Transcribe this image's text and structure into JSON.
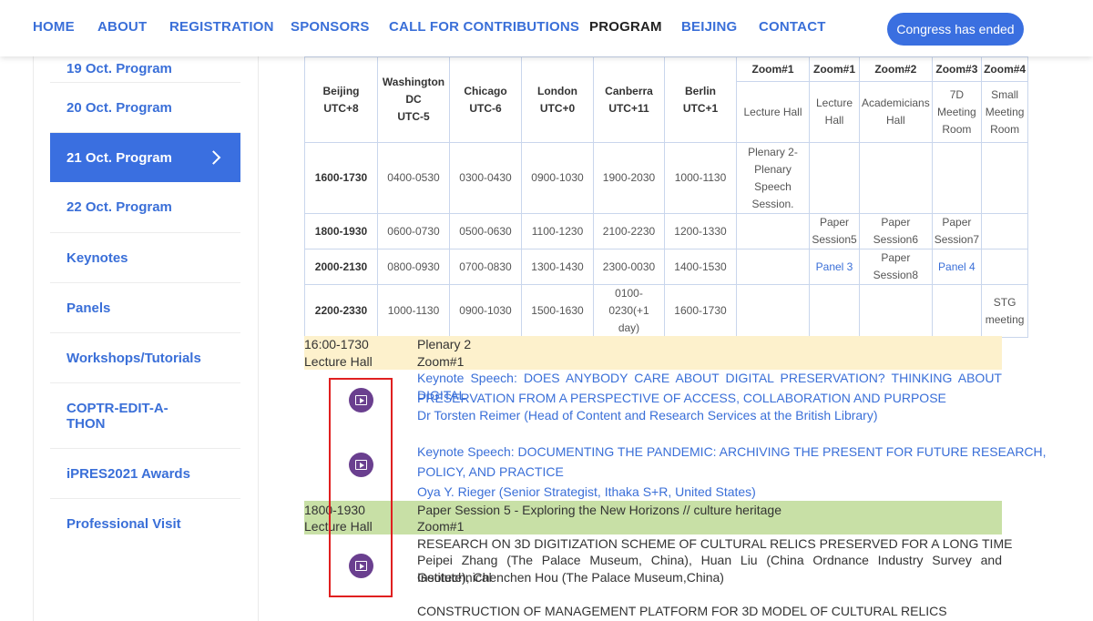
{
  "nav": {
    "items": [
      "HOME",
      "ABOUT",
      "REGISTRATION",
      "SPONSORS",
      "CALL FOR CONTRIBUTIONS",
      "PROGRAM",
      "BEIJING",
      "CONTACT"
    ],
    "button": "Congress has ended"
  },
  "sidebar": {
    "items": [
      "19 Oct. Program",
      "20 Oct. Program",
      "21 Oct. Program",
      "22 Oct. Program",
      "Keynotes",
      "Panels",
      "Workshops/Tutorials",
      "COPTR-EDIT-A-THON",
      "iPRES2021 Awards",
      "Professional Visit"
    ]
  },
  "table": {
    "header": {
      "beijing": [
        "Beijing",
        "UTC+8"
      ],
      "washington": [
        "Washington",
        "DC",
        "UTC-5"
      ],
      "chicago": [
        "Chicago",
        "UTC-6"
      ],
      "london": [
        "London",
        "UTC+0"
      ],
      "canberra": [
        "Canberra",
        "UTC+11"
      ],
      "berlin": [
        "Berlin",
        "UTC+1"
      ],
      "zoom_names": [
        "Zoom#1",
        "Zoom#1",
        "Zoom#2",
        "Zoom#3",
        "Zoom#4"
      ],
      "rooms": [
        [
          "Lecture Hall"
        ],
        [
          "Lecture",
          "Hall"
        ],
        [
          "Academicians",
          "Hall"
        ],
        [
          "7D",
          "Meeting",
          "Room"
        ],
        [
          "Small",
          "Meeting",
          "Room"
        ]
      ]
    },
    "rows": [
      {
        "times": [
          "1600-1730",
          "0400-0530",
          "0300-0430",
          "0900-1030",
          "1900-2030",
          "1000-1130"
        ],
        "plenary": [
          "Plenary 2-",
          "Plenary",
          "Speech",
          "Session."
        ]
      },
      {
        "times": [
          "1800-1930",
          "0600-0730",
          "0500-0630",
          "1100-1230",
          "2100-2230",
          "1200-1330"
        ],
        "z1b": [
          "Paper",
          "Session5"
        ],
        "z2": [
          "Paper",
          "Session6"
        ],
        "z3": [
          "Paper",
          "Session7"
        ]
      },
      {
        "times": [
          "2000-2130",
          "0800-0930",
          "0700-0830",
          "1300-1430",
          "2300-0030",
          "1400-1530"
        ],
        "z1b": "Panel 3",
        "z2": [
          "Paper",
          "Session8"
        ],
        "z3": "Panel 4"
      },
      {
        "times": [
          "2200-2330",
          "1000-1130",
          "0900-1030",
          "1500-1630",
          "0100-0230(+1",
          "day)",
          "1600-1730"
        ],
        "z4": [
          "STG",
          "meeting"
        ]
      }
    ]
  },
  "sessions": {
    "plenary": {
      "time": "16:00-1730",
      "place": "Lecture Hall",
      "title": "Plenary 2",
      "zoom": "Zoom#1",
      "keynote1_line1": "Keynote Speech: DOES ANYBODY CARE ABOUT DIGITAL PRESERVATION? THINKING ABOUT DIGITAL",
      "keynote1_line2": "PRESERVATION FROM A PERSPECTIVE OF ACCESS, COLLABORATION AND PURPOSE",
      "keynote1_speaker": "Dr Torsten Reimer (Head of Content and Research Services at the British Library)",
      "keynote2_line1": "Keynote Speech: DOCUMENTING THE PANDEMIC: ARCHIVING THE PRESENT FOR FUTURE RESEARCH,",
      "keynote2_line2": "POLICY, AND PRACTICE",
      "keynote2_speaker": "Oya Y. Rieger (Senior Strategist, Ithaka S+R, United States)"
    },
    "paper5": {
      "time": "1800-1930",
      "place": "Lecture Hall",
      "title": "Paper Session 5 - Exploring the New Horizons // culture heritage",
      "zoom": "Zoom#1",
      "paper1_title": "RESEARCH ON 3D DIGITIZATION SCHEME OF CULTURAL RELICS PRESERVED FOR A LONG TIME",
      "paper1_authors_line1": "Peipei Zhang (The Palace Museum, China), Huan Liu (China Ordnance Industry Survey and Geotechnical",
      "paper1_authors_line2": "Institute), Chenchen Hou (The Palace Museum,China)",
      "paper2_title": "CONSTRUCTION OF MANAGEMENT PLATFORM FOR 3D MODEL OF CULTURAL RELICS"
    }
  },
  "colors": {
    "accent": "#3a6fe0",
    "plenary_band": "#fdf1cc",
    "paper_band": "#c8e0a6",
    "play_icon": "#6a3f8f",
    "highlight_box": "#e02020"
  }
}
